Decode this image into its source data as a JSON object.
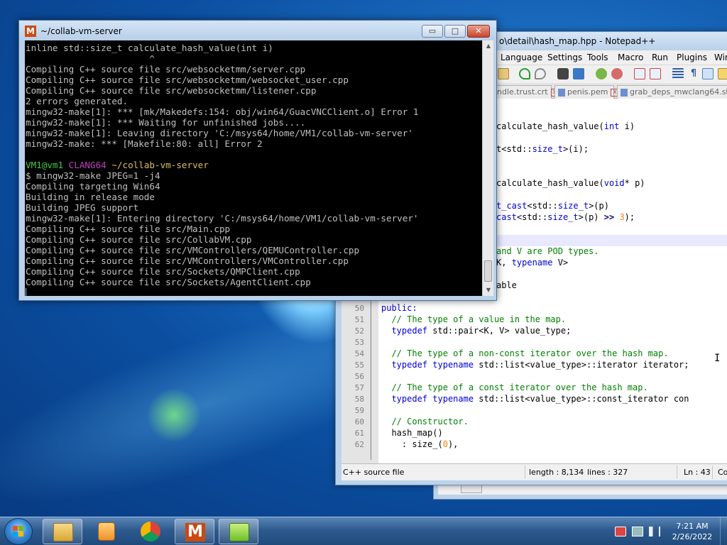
{
  "terminal": {
    "title": "~/collab-vm-server",
    "logo_letter": "M",
    "caption": {
      "minimize": "▭",
      "maximize": "□",
      "close": "✕"
    },
    "lines": [
      {
        "segments": [
          {
            "text": "inline std::size_t calculate_hash_value(int i)",
            "color": "default"
          }
        ]
      },
      {
        "segments": [
          {
            "text": "                       ^",
            "color": "default"
          }
        ]
      },
      {
        "segments": [
          {
            "text": "Compiling C++ source file src/websocketmm/server.cpp",
            "color": "default"
          }
        ]
      },
      {
        "segments": [
          {
            "text": "Compiling C++ source file src/websocketmm/websocket_user.cpp",
            "color": "default"
          }
        ]
      },
      {
        "segments": [
          {
            "text": "Compiling C++ source file src/websocketmm/listener.cpp",
            "color": "default"
          }
        ]
      },
      {
        "segments": [
          {
            "text": "2 errors generated.",
            "color": "default"
          }
        ]
      },
      {
        "segments": [
          {
            "text": "mingw32-make[1]: *** [mk/Makedefs:154: obj/win64/GuacVNCClient.o] Error 1",
            "color": "default"
          }
        ]
      },
      {
        "segments": [
          {
            "text": "mingw32-make[1]: *** Waiting for unfinished jobs....",
            "color": "default"
          }
        ]
      },
      {
        "segments": [
          {
            "text": "mingw32-make[1]: Leaving directory 'C:/msys64/home/VM1/collab-vm-server'",
            "color": "default"
          }
        ]
      },
      {
        "segments": [
          {
            "text": "mingw32-make: *** [Makefile:80: all] Error 2",
            "color": "default"
          }
        ]
      },
      {
        "segments": [
          {
            "text": "",
            "color": "default"
          }
        ]
      },
      {
        "segments": [
          {
            "text": "VM1@vm1 ",
            "color": "green"
          },
          {
            "text": "CLANG64 ",
            "color": "magenta"
          },
          {
            "text": "~/collab-vm-server",
            "color": "yellow"
          }
        ]
      },
      {
        "segments": [
          {
            "text": "$ mingw32-make JPEG=1 -j4",
            "color": "default"
          }
        ]
      },
      {
        "segments": [
          {
            "text": "Compiling targeting Win64",
            "color": "default"
          }
        ]
      },
      {
        "segments": [
          {
            "text": "Building in release mode",
            "color": "default"
          }
        ]
      },
      {
        "segments": [
          {
            "text": "Building JPEG support",
            "color": "default"
          }
        ]
      },
      {
        "segments": [
          {
            "text": "mingw32-make[1]: Entering directory 'C:/msys64/home/VM1/collab-vm-server'",
            "color": "default"
          }
        ]
      },
      {
        "segments": [
          {
            "text": "Compiling C++ source file src/Main.cpp",
            "color": "default"
          }
        ]
      },
      {
        "segments": [
          {
            "text": "Compiling C++ source file src/CollabVM.cpp",
            "color": "default"
          }
        ]
      },
      {
        "segments": [
          {
            "text": "Compiling C++ source file src/VMControllers/QEMUController.cpp",
            "color": "default"
          }
        ]
      },
      {
        "segments": [
          {
            "text": "Compiling C++ source file src/VMControllers/VMController.cpp",
            "color": "default"
          }
        ]
      },
      {
        "segments": [
          {
            "text": "Compiling C++ source file src/Sockets/QMPClient.cpp",
            "color": "default"
          }
        ]
      },
      {
        "segments": [
          {
            "text": "Compiling C++ source file src/Sockets/AgentClient.cpp",
            "color": "default"
          }
        ]
      }
    ]
  },
  "notepad": {
    "title": "o\\detail\\hash_map.hpp - Notepad++",
    "menu": [
      "Language",
      "Settings",
      "Tools",
      "Macro",
      "Run",
      "Plugins",
      "Win"
    ],
    "tabs": [
      "ndle.trust.crt",
      "penis.pem",
      "grab_deps_mwclang64.sh"
    ],
    "tab_close": "x",
    "top_code": [
      {
        "segments": []
      },
      {
        "segments": []
      },
      {
        "segments": [
          {
            "t": "calculate_hash_value(",
            "c": "fn"
          },
          {
            "t": "int",
            "c": "kw"
          },
          {
            "t": " i)",
            "c": "fn"
          }
        ]
      },
      {
        "segments": []
      },
      {
        "segments": [
          {
            "t": "t<std::",
            "c": "fn"
          },
          {
            "t": "size_t",
            "c": "kw"
          },
          {
            "t": ">(i);",
            "c": "fn"
          }
        ]
      },
      {
        "segments": []
      },
      {
        "segments": []
      },
      {
        "segments": [
          {
            "t": "calculate_hash_value(",
            "c": "fn"
          },
          {
            "t": "void",
            "c": "kw"
          },
          {
            "t": "* p)",
            "c": "fn"
          }
        ]
      },
      {
        "segments": []
      },
      {
        "segments": [
          {
            "t": "t_cast",
            "c": "kw"
          },
          {
            "t": "<std::",
            "c": "fn"
          },
          {
            "t": "size_t",
            "c": "kw"
          },
          {
            "t": ">(p)",
            "c": "fn"
          }
        ]
      },
      {
        "segments": [
          {
            "t": "cast",
            "c": "kw"
          },
          {
            "t": "<std::",
            "c": "fn"
          },
          {
            "t": "size_t",
            "c": "kw"
          },
          {
            "t": ">(p) ",
            "c": "fn"
          },
          {
            "t": ">>",
            "c": "op"
          },
          {
            "t": " ",
            "c": "fn"
          },
          {
            "t": "3",
            "c": "num"
          },
          {
            "t": ");",
            "c": "fn"
          }
        ]
      },
      {
        "segments": []
      },
      {
        "segments": []
      },
      {
        "segments": [
          {
            "t": "and V are POD types.",
            "c": "cm"
          }
        ]
      },
      {
        "segments": [
          {
            "t": "K, ",
            "c": "fn"
          },
          {
            "t": "typename",
            "c": "kw"
          },
          {
            "t": " V>",
            "c": "fn"
          }
        ]
      },
      {
        "segments": []
      },
      {
        "segments": [
          {
            "t": "able",
            "c": "fn"
          }
        ]
      }
    ],
    "numbered_code": [
      {
        "n": "49",
        "segments": [
          {
            "t": "{",
            "c": "fn"
          }
        ]
      },
      {
        "n": "50",
        "segments": [
          {
            "t": "public:",
            "c": "kw"
          }
        ]
      },
      {
        "n": "51",
        "segments": [
          {
            "t": "  // The type of a value in the map.",
            "c": "cm"
          }
        ]
      },
      {
        "n": "52",
        "segments": [
          {
            "t": "  ",
            "c": "fn"
          },
          {
            "t": "typedef",
            "c": "kw"
          },
          {
            "t": " std::pair<K, V> value_type;",
            "c": "fn"
          }
        ]
      },
      {
        "n": "53",
        "segments": []
      },
      {
        "n": "54",
        "segments": [
          {
            "t": "  // The type of a non-const iterator over the hash map.",
            "c": "cm"
          }
        ]
      },
      {
        "n": "55",
        "segments": [
          {
            "t": "  ",
            "c": "fn"
          },
          {
            "t": "typedef",
            "c": "kw"
          },
          {
            "t": " ",
            "c": "fn"
          },
          {
            "t": "typename",
            "c": "kw"
          },
          {
            "t": " std::list<value_type>::iterator iterator;",
            "c": "fn"
          }
        ]
      },
      {
        "n": "56",
        "segments": []
      },
      {
        "n": "57",
        "segments": [
          {
            "t": "  // The type of a const iterator over the hash map.",
            "c": "cm"
          }
        ]
      },
      {
        "n": "58",
        "segments": [
          {
            "t": "  ",
            "c": "fn"
          },
          {
            "t": "typedef",
            "c": "kw"
          },
          {
            "t": " ",
            "c": "fn"
          },
          {
            "t": "typename",
            "c": "kw"
          },
          {
            "t": " std::list<value_type>::const_iterator con",
            "c": "fn"
          }
        ]
      },
      {
        "n": "59",
        "segments": []
      },
      {
        "n": "60",
        "segments": [
          {
            "t": "  // Constructor.",
            "c": "cm"
          }
        ]
      },
      {
        "n": "61",
        "segments": [
          {
            "t": "  hash_map()",
            "c": "fn"
          }
        ]
      },
      {
        "n": "62",
        "segments": [
          {
            "t": "    : size_(",
            "c": "fn"
          },
          {
            "t": "0",
            "c": "num"
          },
          {
            "t": "),",
            "c": "fn"
          }
        ]
      }
    ],
    "status": {
      "type": "C++ source file",
      "length": "length : 8,134",
      "lines": "lines : 327",
      "ln": "Ln : 43",
      "col": "Co"
    }
  },
  "taskbar": {
    "clock_time": "7:21 AM",
    "clock_date": "2/26/2022",
    "items": [
      "explorer",
      "media-player",
      "chrome",
      "msys2-terminal",
      "notepad-plus-plus"
    ]
  },
  "colors": {
    "term_default": "#c0c0c0",
    "term_green": "#44cc44",
    "term_magenta": "#c040c0",
    "term_yellow": "#d7c05a",
    "code_keyword": "#0000d0",
    "code_comment": "#008000",
    "code_number": "#ff8000"
  }
}
